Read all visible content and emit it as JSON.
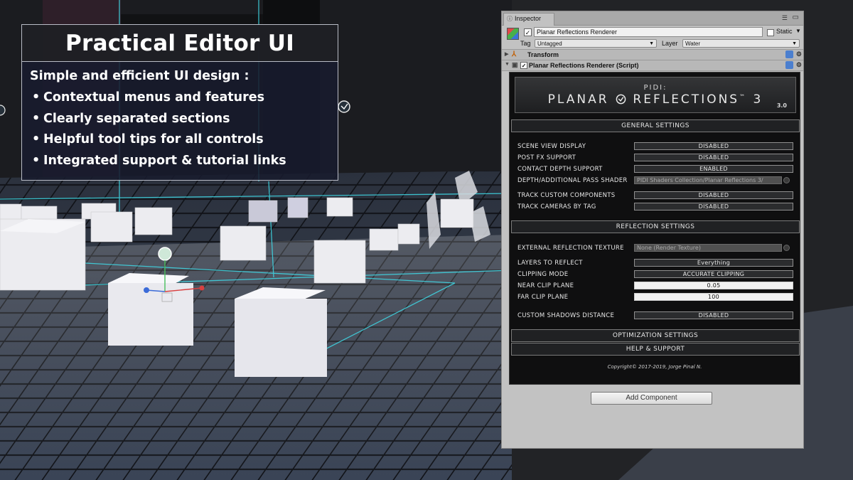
{
  "promo": {
    "title": "Practical Editor UI",
    "subtitle": "Simple and efficient UI design :",
    "bullets": [
      "Contextual menus and features",
      "Clearly separated sections",
      "Helpful tool tips for all controls",
      "Integrated support & tutorial links"
    ]
  },
  "inspector": {
    "tab_label": "Inspector",
    "gameobject": {
      "name": "Planar Reflections Renderer",
      "static_label": "Static",
      "tag_label": "Tag",
      "tag_value": "Untagged",
      "layer_label": "Layer",
      "layer_value": "Water"
    },
    "components": {
      "transform": "Transform",
      "script": "Planar Reflections Renderer (Script)"
    },
    "panel": {
      "logo_top": "PIDI:",
      "logo_main_a": "PLANAR",
      "logo_main_b": "REFLECTIONS",
      "logo_tm": "™",
      "logo_num": "3",
      "version": "3.0",
      "general_settings": "GENERAL SETTINGS",
      "reflection_settings": "REFLECTION SETTINGS",
      "optimization_settings": "OPTIMIZATION SETTINGS",
      "help_support": "HELP & SUPPORT",
      "general_rows": [
        {
          "label": "SCENE VIEW DISPLAY",
          "value": "DISABLED"
        },
        {
          "label": "POST FX SUPPORT",
          "value": "DISABLED"
        },
        {
          "label": "CONTACT DEPTH SUPPORT",
          "value": "ENABLED"
        },
        {
          "label": "DEPTH/ADDITIONAL PASS SHADER",
          "value": "PIDI Shaders Collection/Planar Reflections 3/"
        },
        {
          "label": "TRACK CUSTOM COMPONENTS",
          "value": "DISABLED"
        },
        {
          "label": "TRACK CAMERAS BY TAG",
          "value": "DISABLED"
        }
      ],
      "reflection_rows": [
        {
          "label": "EXTERNAL REFLECTION TEXTURE",
          "value": "None (Render Texture)"
        },
        {
          "label": "LAYERS TO REFLECT",
          "value": "Everything"
        },
        {
          "label": "CLIPPING MODE",
          "value": "ACCURATE CLIPPING"
        },
        {
          "label": "NEAR CLIP PLANE",
          "value": "0.05"
        },
        {
          "label": "FAR CLIP PLANE",
          "value": "100"
        },
        {
          "label": "CUSTOM SHADOWS DISTANCE",
          "value": "DISABLED"
        }
      ],
      "copyright": "Copyright© 2017-2019,  Jorge Pinal N."
    },
    "add_component": "Add Component"
  },
  "colors": {
    "scene_cyan": "#3fd9e6",
    "promo_bg": "#181b2d",
    "inspector_bg": "#c2c2c2",
    "panel_bg": "#0f0f10"
  },
  "icons": [
    "gameobject-cube-icon",
    "transform-icon",
    "script-icon",
    "help-icon",
    "gear-icon",
    "lock-icon",
    "menu-icon",
    "move-gizmo-icon"
  ]
}
